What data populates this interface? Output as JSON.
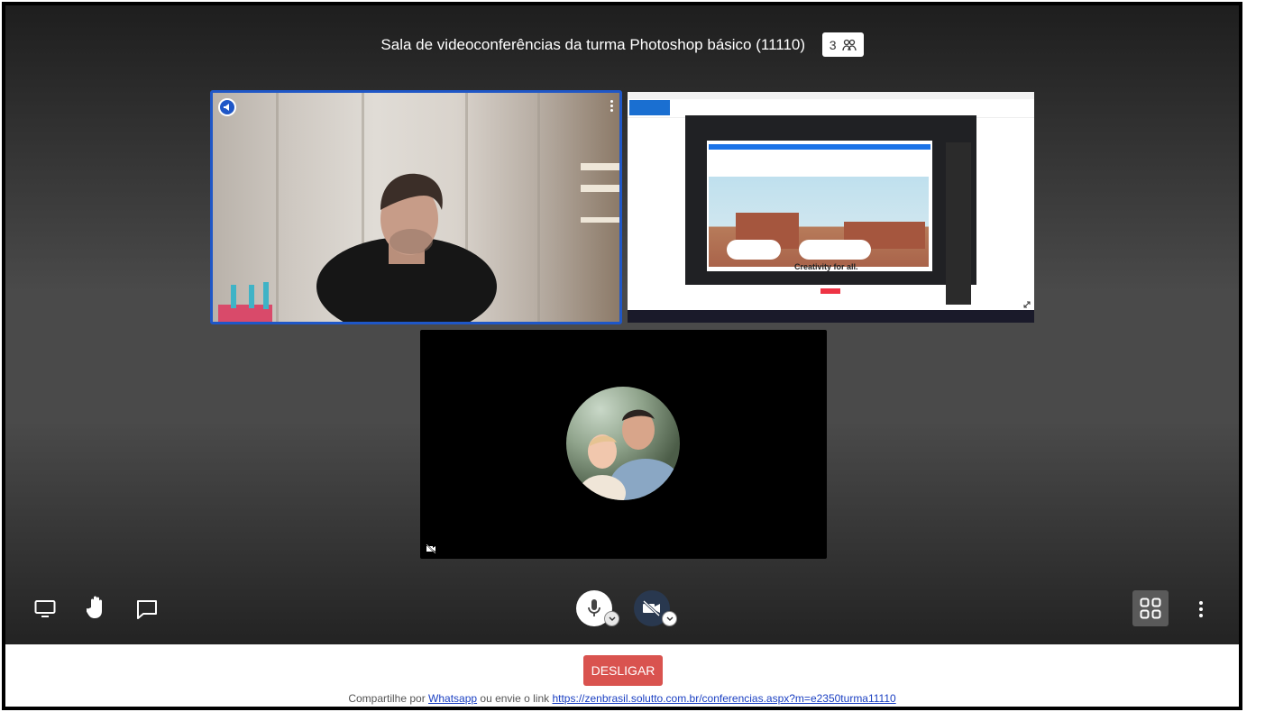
{
  "header": {
    "title": "Sala de videoconferências da turma Photoshop básico (11110)",
    "participant_count": "3",
    "participants_icon": "users-icon"
  },
  "tiles": {
    "speaker": {
      "badge_icon": "megaphone-icon",
      "menu_icon": "kebab-menu-icon",
      "highlight_color": "#1f57c7"
    },
    "screen_share": {
      "hero_text": "Creativity for all.",
      "expand_icon": "expand-icon"
    },
    "avatar": {
      "status_icon": "camera-off-icon"
    }
  },
  "toolbar": {
    "left": [
      "screen-share-icon",
      "raise-hand-icon",
      "chat-icon"
    ],
    "center": {
      "mic_icon": "microphone-icon",
      "camera_icon": "camera-off-icon",
      "camera_muted": true
    },
    "right": {
      "layout_icon": "grid-layout-icon",
      "more_icon": "more-vertical-icon"
    }
  },
  "footer": {
    "hangup_label": "DESLIGAR",
    "hangup_color": "#d9534f",
    "share_prefix": "Compartilhe por",
    "share_whatsapp": "Whatsapp",
    "share_middle": "ou envie o link",
    "share_link": "https://zenbrasil.solutto.com.br/conferencias.aspx?m=e2350turma11110"
  }
}
